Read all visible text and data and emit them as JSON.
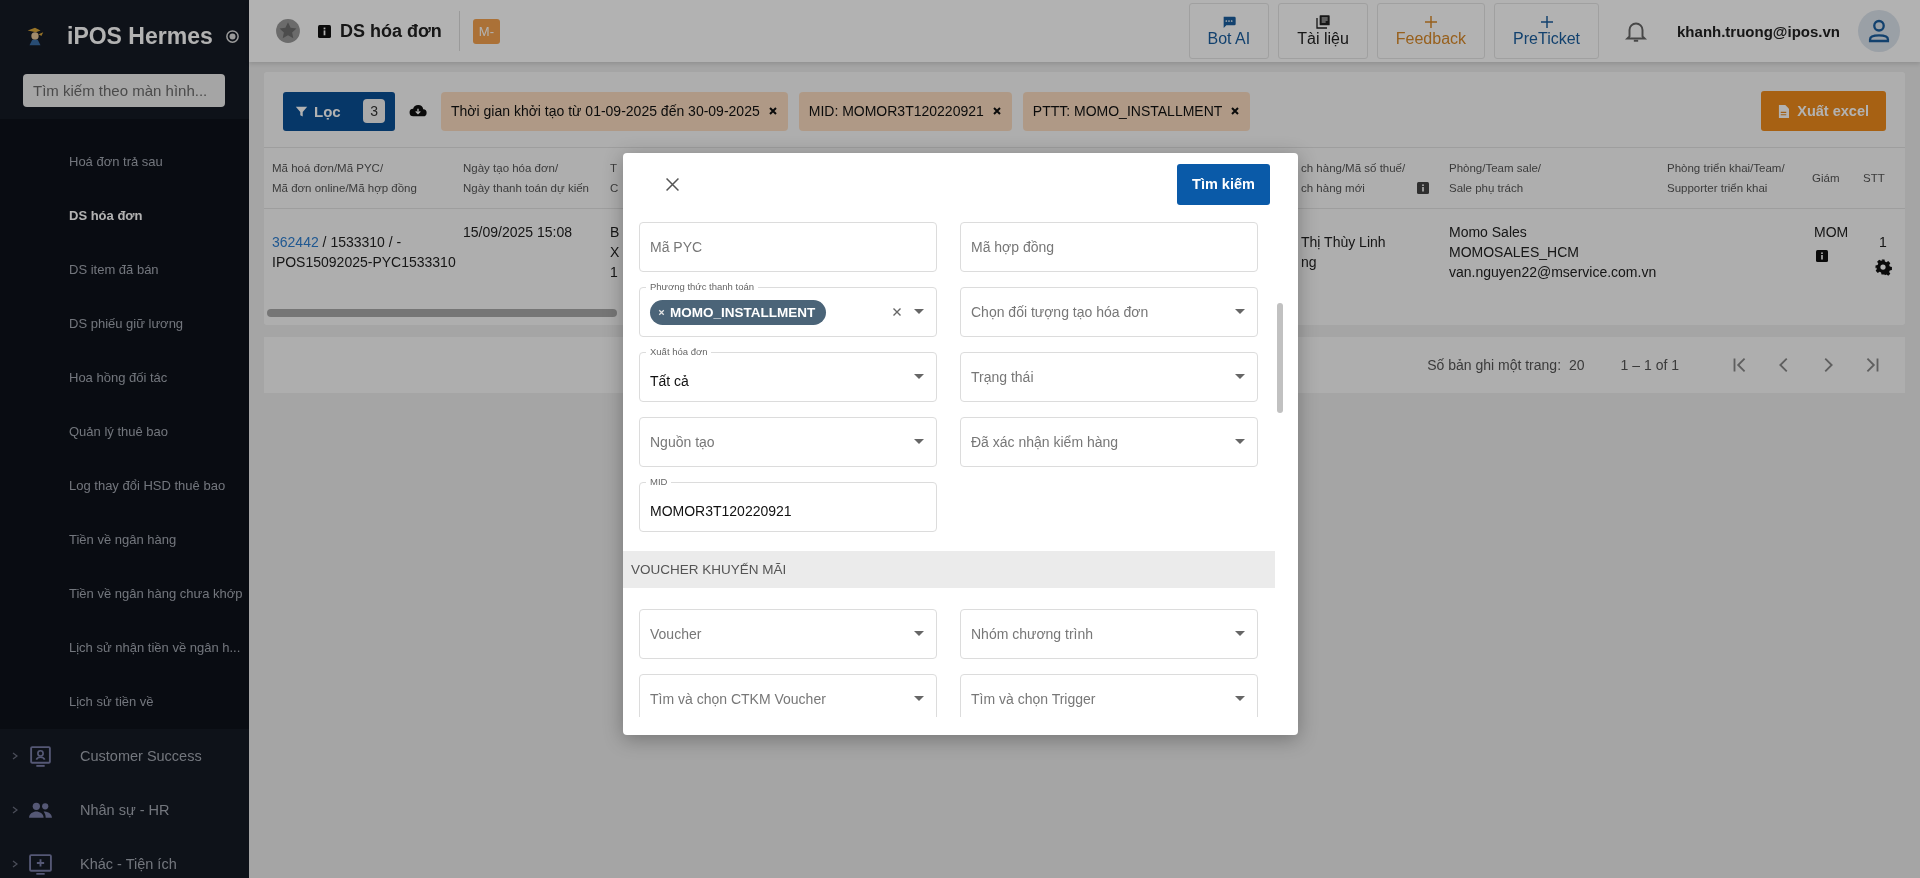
{
  "sidebar": {
    "app_name": "iPOS Hermes",
    "search_placeholder": "Tìm kiếm theo màn hình...",
    "items": [
      {
        "label": "Hoá đơn trả sau",
        "selected": false
      },
      {
        "label": "DS hóa đơn",
        "selected": true
      },
      {
        "label": "DS item đã bán",
        "selected": false
      },
      {
        "label": "DS phiếu giữ lương",
        "selected": false
      },
      {
        "label": "Hoa hồng đối tác",
        "selected": false
      },
      {
        "label": "Quản lý thuê bao",
        "selected": false
      },
      {
        "label": "Log thay đổi HSD thuê bao",
        "selected": false
      },
      {
        "label": "Tiền về ngân hàng",
        "selected": false
      },
      {
        "label": "Tiền về ngân hàng chưa khớp",
        "selected": false
      },
      {
        "label": "Lịch sử nhận tiền về ngân h...",
        "selected": false
      },
      {
        "label": "Lịch sử tiền về",
        "selected": false
      }
    ],
    "groups": [
      {
        "label": "Customer Success",
        "kind": "monitor",
        "expanded": false
      },
      {
        "label": "Nhân sự - HR",
        "kind": "people",
        "expanded": false
      },
      {
        "label": "Khác - Tiện ích",
        "kind": "add",
        "expanded": false
      }
    ]
  },
  "header": {
    "title": "DS hóa đơn",
    "badge": "M-",
    "buttons": [
      {
        "label": "Bot AI",
        "kind": "chat"
      },
      {
        "label": "Tài liệu",
        "kind": "book"
      },
      {
        "label": "Feedback",
        "kind": "plus-orange"
      },
      {
        "label": "PreTicket",
        "kind": "plus-blue"
      }
    ],
    "user": "khanh.truong@ipos.vn"
  },
  "toolbar": {
    "filter_button": "Lọc",
    "filter_count": "3",
    "chips": [
      "Thời gian khởi tạo từ 01-09-2025 đến 30-09-2025",
      "MID: MOMOR3T120220921",
      "PTTT: MOMO_INSTALLMENT"
    ],
    "export_button": "Xuất excel"
  },
  "table": {
    "columns": [
      {
        "lines": [
          "Mã hoá đơn/Mã PYC/",
          "Mã đơn online/Mã hợp đồng"
        ],
        "info": false
      },
      {
        "lines": [
          "Ngày tạo hóa đơn/",
          "Ngày thanh toán dự kiến"
        ],
        "info": false
      },
      {
        "lines": [
          "T",
          "C"
        ],
        "info": false
      },
      {
        "lines": [
          "ch hàng/Mã số thuế/",
          "ch hàng mới"
        ],
        "info": true
      },
      {
        "lines": [
          "Phòng/Team sale/",
          "Sale phụ trách"
        ],
        "info": false
      },
      {
        "lines": [
          "Phòng triển khai/Team/",
          "Supporter triển khai"
        ],
        "info": false
      },
      {
        "lines": [
          "Giám"
        ],
        "info": false
      },
      {
        "lines": [
          "STT"
        ],
        "info": false
      }
    ],
    "rows": [
      {
        "invoice_id": "362442",
        "codes": "/ 1533310 / -",
        "online_code": "IPOS15092025-PYC1533310",
        "created": "15/09/2025 15:08",
        "column_3": [
          "B",
          "X",
          "1"
        ],
        "customer": [
          "Thị Thùy Linh",
          "ng"
        ],
        "sales": [
          "Momo Sales",
          "MOMOSALES_HCM",
          "van.nguyen22@mservice.com.vn"
        ],
        "column_7": "MOM",
        "stt": "1"
      }
    ]
  },
  "pagination": {
    "page_size_label": "Số bản ghi một trang:",
    "page_size": "20",
    "range": "1 – 1 of 1"
  },
  "modal": {
    "search_button": "Tìm kiếm",
    "fields": [
      {
        "kind": "text",
        "placeholder": "Mã PYC"
      },
      {
        "kind": "text",
        "placeholder": "Mã hợp đồng"
      },
      {
        "kind": "multiselect",
        "label": "Phương thức thanh toán",
        "chips": [
          "MOMO_INSTALLMENT"
        ]
      },
      {
        "kind": "select",
        "placeholder": "Chọn đối tượng tạo hóa đơn"
      },
      {
        "kind": "select",
        "label": "Xuất hóa đơn",
        "value": "Tất cả"
      },
      {
        "kind": "select",
        "placeholder": "Trạng thái"
      },
      {
        "kind": "select",
        "placeholder": "Nguồn tạo"
      },
      {
        "kind": "select",
        "placeholder": "Đã xác nhận kiểm hàng"
      },
      {
        "kind": "text",
        "label": "MID",
        "value": "MOMOR3T120220921"
      }
    ],
    "section": "VOUCHER KHUYẾN MÃI",
    "voucher_fields": [
      {
        "kind": "select",
        "placeholder": "Voucher"
      },
      {
        "kind": "select",
        "placeholder": "Nhóm chương trình"
      },
      {
        "kind": "select",
        "placeholder": "Tìm và chọn CTKM Voucher"
      },
      {
        "kind": "select",
        "placeholder": "Tìm và chọn Trigger"
      }
    ]
  }
}
